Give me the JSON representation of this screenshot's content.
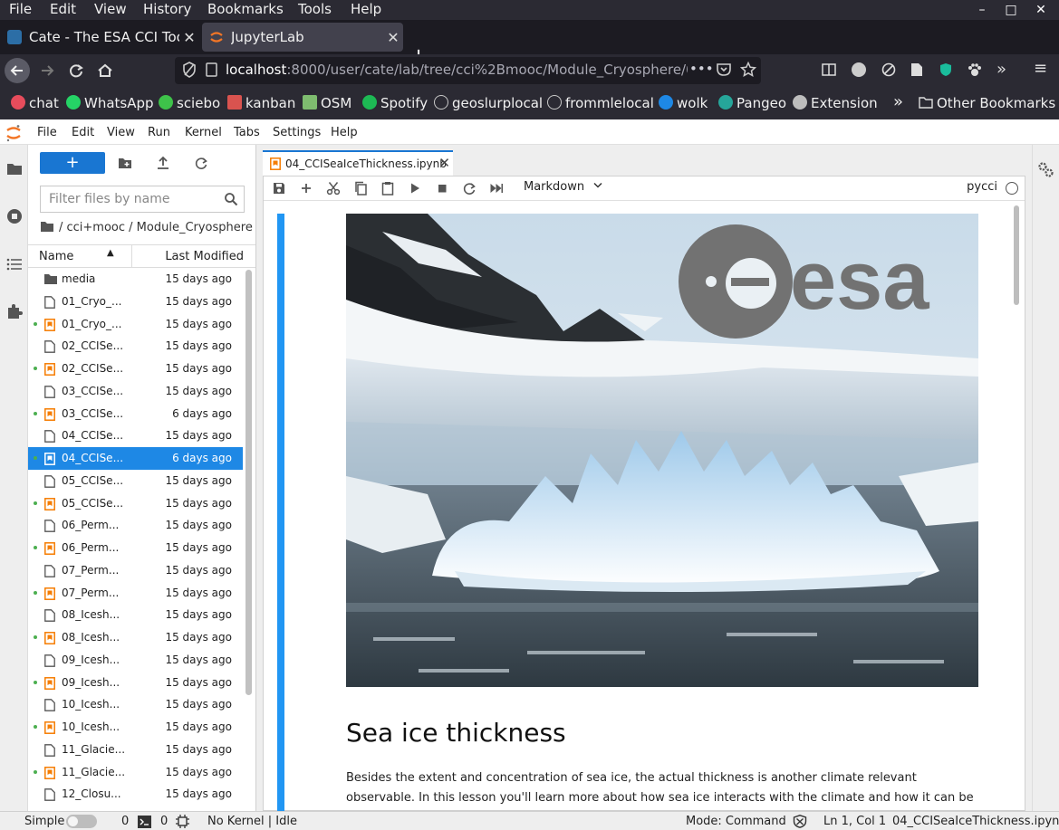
{
  "browser": {
    "menu": [
      "File",
      "Edit",
      "View",
      "History",
      "Bookmarks",
      "Tools",
      "Help"
    ],
    "window_controls": {
      "minimize": "–",
      "maximize": "□",
      "close": "✕"
    },
    "tabs": [
      {
        "label": "Cate - The ESA CCI Toolb",
        "close": "✕",
        "favicon_color": "#2c6ea6"
      },
      {
        "label": "JupyterLab",
        "close": "✕",
        "favicon_color": "#f37626"
      }
    ],
    "new_tab": "+",
    "url": {
      "host": "localhost",
      "path": ":8000/user/cate/lab/tree/cci%2Bmooc/Module_Cryosphere/0"
    },
    "more_actions": "•••",
    "overflow": "»",
    "hamburger": "≡",
    "bookmarks": [
      {
        "label": "chat",
        "color": "#e74c5c"
      },
      {
        "label": "WhatsApp",
        "color": "#25d366"
      },
      {
        "label": "sciebo",
        "color": "#3ec24a"
      },
      {
        "label": "kanban",
        "color": "#d9534f"
      },
      {
        "label": "OSM",
        "color": "#7ebc6f"
      },
      {
        "label": "Spotify",
        "color": "#1db954"
      },
      {
        "label": "geoslurplocal",
        "color": "#c8c8c8"
      },
      {
        "label": "frommlelocal",
        "color": "#c8c8c8"
      },
      {
        "label": "wolk",
        "color": "#1e88e5"
      },
      {
        "label": "Pangeo",
        "color": "#26a69a"
      },
      {
        "label": "Extension",
        "color": "#bdbdbd"
      }
    ],
    "bookmarks_overflow": "»",
    "other_bookmarks": "Other Bookmarks"
  },
  "jupyter": {
    "menu": [
      "File",
      "Edit",
      "View",
      "Run",
      "Kernel",
      "Tabs",
      "Settings",
      "Help"
    ],
    "filebrowser": {
      "new_launcher": "+",
      "filter_placeholder": "Filter files by name",
      "breadcrumb": "/ cci+mooc / Module_Cryosphere /",
      "col_name": "Name",
      "col_modified": "Last Modified",
      "sort_arrow": "▲",
      "files": [
        {
          "name": "media",
          "modified": "15 days ago",
          "type": "folder",
          "running": false,
          "selected": false
        },
        {
          "name": "01_Cryo_...",
          "modified": "15 days ago",
          "type": "file",
          "running": false,
          "selected": false
        },
        {
          "name": "01_Cryo_...",
          "modified": "15 days ago",
          "type": "notebook",
          "running": true,
          "selected": false
        },
        {
          "name": "02_CCISe...",
          "modified": "15 days ago",
          "type": "file",
          "running": false,
          "selected": false
        },
        {
          "name": "02_CCISe...",
          "modified": "15 days ago",
          "type": "notebook",
          "running": true,
          "selected": false
        },
        {
          "name": "03_CCISe...",
          "modified": "15 days ago",
          "type": "file",
          "running": false,
          "selected": false
        },
        {
          "name": "03_CCISe...",
          "modified": "6 days ago",
          "type": "notebook",
          "running": true,
          "selected": false
        },
        {
          "name": "04_CCISe...",
          "modified": "15 days ago",
          "type": "file",
          "running": false,
          "selected": false
        },
        {
          "name": "04_CCISe...",
          "modified": "6 days ago",
          "type": "notebook",
          "running": true,
          "selected": true
        },
        {
          "name": "05_CCISe...",
          "modified": "15 days ago",
          "type": "file",
          "running": false,
          "selected": false
        },
        {
          "name": "05_CCISe...",
          "modified": "15 days ago",
          "type": "notebook",
          "running": true,
          "selected": false
        },
        {
          "name": "06_Perm...",
          "modified": "15 days ago",
          "type": "file",
          "running": false,
          "selected": false
        },
        {
          "name": "06_Perm...",
          "modified": "15 days ago",
          "type": "notebook",
          "running": true,
          "selected": false
        },
        {
          "name": "07_Perm...",
          "modified": "15 days ago",
          "type": "file",
          "running": false,
          "selected": false
        },
        {
          "name": "07_Perm...",
          "modified": "15 days ago",
          "type": "notebook",
          "running": true,
          "selected": false
        },
        {
          "name": "08_Icesh...",
          "modified": "15 days ago",
          "type": "file",
          "running": false,
          "selected": false
        },
        {
          "name": "08_Icesh...",
          "modified": "15 days ago",
          "type": "notebook",
          "running": true,
          "selected": false
        },
        {
          "name": "09_Icesh...",
          "modified": "15 days ago",
          "type": "file",
          "running": false,
          "selected": false
        },
        {
          "name": "09_Icesh...",
          "modified": "15 days ago",
          "type": "notebook",
          "running": true,
          "selected": false
        },
        {
          "name": "10_Icesh...",
          "modified": "15 days ago",
          "type": "file",
          "running": false,
          "selected": false
        },
        {
          "name": "10_Icesh...",
          "modified": "15 days ago",
          "type": "notebook",
          "running": true,
          "selected": false
        },
        {
          "name": "11_Glacie...",
          "modified": "15 days ago",
          "type": "file",
          "running": false,
          "selected": false
        },
        {
          "name": "11_Glacie...",
          "modified": "15 days ago",
          "type": "notebook",
          "running": true,
          "selected": false
        },
        {
          "name": "12_Closu...",
          "modified": "15 days ago",
          "type": "file",
          "running": false,
          "selected": false
        }
      ]
    },
    "notebook": {
      "tab_label": "04_CCISeaIceThickness.ipynb",
      "tab_close": "✕",
      "cell_type": "Markdown",
      "kernel": "pycci",
      "hero_logo_text": "esa",
      "heading": "Sea ice thickness",
      "intro": "Besides the extent and concentration of sea ice, the actual thickness is another climate relevant observable. In this lesson you'll learn more about how sea ice interacts with the climate and how it can be observed using"
    },
    "status": {
      "mode_label": "Simple",
      "terminals": "0",
      "kernels": "0",
      "kernel_state": "No Kernel | Idle",
      "mode": "Mode: Command",
      "position": "Ln 1, Col 1",
      "file": "04_CCISeaIceThickness.ipynb"
    },
    "colors": {
      "accent": "#1976d2",
      "selected_row": "#1e88e5",
      "notebook_icon": "#f57c00",
      "running_dot": "#4caf50"
    }
  }
}
